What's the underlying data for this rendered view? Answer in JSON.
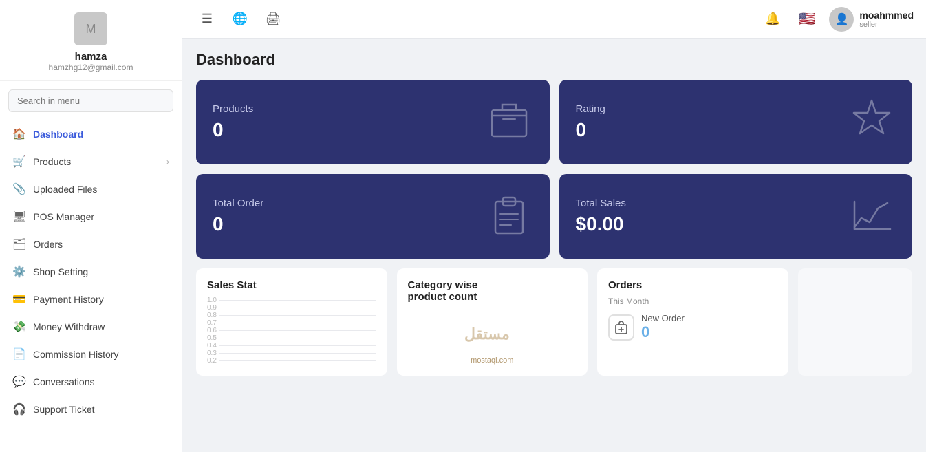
{
  "sidebar": {
    "profile": {
      "avatar_placeholder": "M",
      "username": "hamza",
      "email": "hamzhg12@gmail.com"
    },
    "search_placeholder": "Search in menu",
    "nav_items": [
      {
        "id": "dashboard",
        "label": "Dashboard",
        "icon": "🏠",
        "active": true,
        "has_chevron": false
      },
      {
        "id": "products",
        "label": "Products",
        "icon": "🛒",
        "active": false,
        "has_chevron": true
      },
      {
        "id": "uploaded-files",
        "label": "Uploaded Files",
        "icon": "📎",
        "active": false,
        "has_chevron": false
      },
      {
        "id": "pos-manager",
        "label": "POS Manager",
        "icon": "🖥",
        "active": false,
        "has_chevron": false
      },
      {
        "id": "orders",
        "label": "Orders",
        "icon": "🗂",
        "active": false,
        "has_chevron": false
      },
      {
        "id": "shop-setting",
        "label": "Shop Setting",
        "icon": "⚙️",
        "active": false,
        "has_chevron": false
      },
      {
        "id": "payment-history",
        "label": "Payment History",
        "icon": "💳",
        "active": false,
        "has_chevron": false
      },
      {
        "id": "money-withdraw",
        "label": "Money Withdraw",
        "icon": "💸",
        "active": false,
        "has_chevron": false
      },
      {
        "id": "commission-history",
        "label": "Commission History",
        "icon": "📄",
        "active": false,
        "has_chevron": false
      },
      {
        "id": "conversations",
        "label": "Conversations",
        "icon": "💬",
        "active": false,
        "has_chevron": false
      },
      {
        "id": "support-ticket",
        "label": "Support Ticket",
        "icon": "🎧",
        "active": false,
        "has_chevron": false
      }
    ]
  },
  "header": {
    "menu_icon": "☰",
    "globe_icon": "🌐",
    "print_icon": "🖨",
    "bell_icon": "🔔",
    "flag_icon": "🇺🇸",
    "user": {
      "name": "moahmmed",
      "role": "seller"
    }
  },
  "dashboard": {
    "page_title": "Dashboard",
    "stat_cards": [
      {
        "id": "products",
        "label": "Products",
        "value": "0"
      },
      {
        "id": "rating",
        "label": "Rating",
        "value": "0"
      },
      {
        "id": "total-order",
        "label": "Total Order",
        "value": "0"
      },
      {
        "id": "total-sales",
        "label": "Total Sales",
        "value": "$0.00"
      }
    ],
    "widgets": {
      "sales_stat": {
        "title": "Sales Stat",
        "y_labels": [
          "1.0",
          "0.9",
          "0.8",
          "0.7",
          "0.6",
          "0.5",
          "0.4",
          "0.3",
          "0.2"
        ]
      },
      "category": {
        "title": "Category wise product count",
        "watermark": "mostaql.com"
      },
      "orders": {
        "title": "Orders",
        "subtitle": "This Month",
        "new_order_label": "New Order",
        "new_order_count": "0"
      }
    }
  }
}
